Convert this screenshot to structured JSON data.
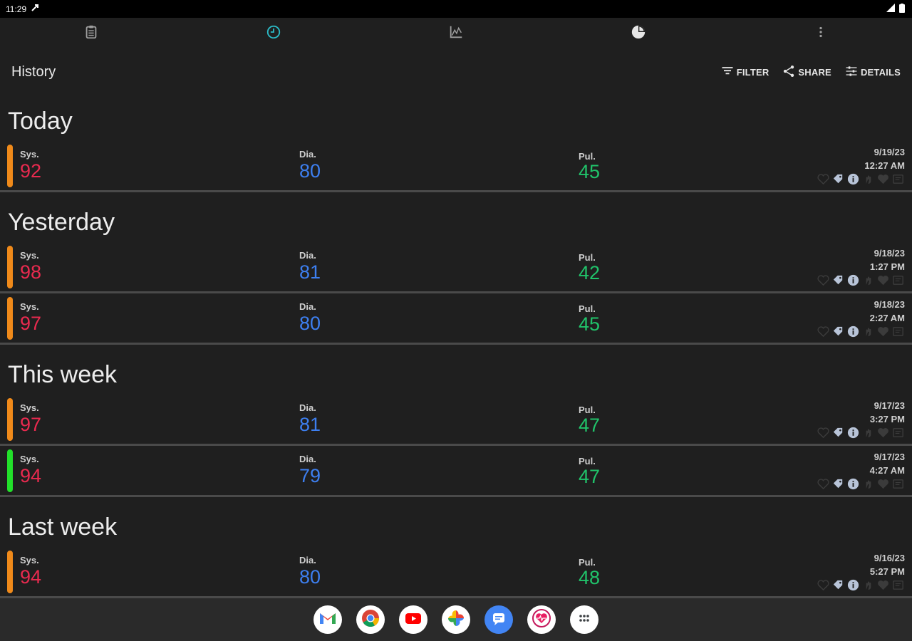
{
  "status": {
    "time": "11:29"
  },
  "nav": {
    "tabs": [
      {
        "name": "clipboard-icon",
        "active": false
      },
      {
        "name": "history-icon",
        "active": true
      },
      {
        "name": "chart-icon",
        "active": false
      },
      {
        "name": "pie-chart-icon",
        "active": false
      },
      {
        "name": "more-icon",
        "active": false
      }
    ]
  },
  "toolbar": {
    "title": "History",
    "filter_label": "FILTER",
    "share_label": "SHARE",
    "details_label": "DETAILS"
  },
  "labels": {
    "sys": "Sys.",
    "dia": "Dia.",
    "pul": "Pul."
  },
  "colors": {
    "sys": "#ea2a4f",
    "dia": "#3d7ff0",
    "pul": "#20c36a",
    "status_orange": "#f08a1a",
    "status_green": "#22e02a",
    "active_tab": "#2bbcc8"
  },
  "sections": [
    {
      "title": "Today",
      "entries": [
        {
          "sys": "92",
          "dia": "80",
          "pul": "45",
          "date": "9/19/23",
          "time": "12:27 AM",
          "status_color": "orange"
        }
      ]
    },
    {
      "title": "Yesterday",
      "entries": [
        {
          "sys": "98",
          "dia": "81",
          "pul": "42",
          "date": "9/18/23",
          "time": "1:27 PM",
          "status_color": "orange"
        },
        {
          "sys": "97",
          "dia": "80",
          "pul": "45",
          "date": "9/18/23",
          "time": "2:27 AM",
          "status_color": "orange"
        }
      ]
    },
    {
      "title": "This week",
      "entries": [
        {
          "sys": "97",
          "dia": "81",
          "pul": "47",
          "date": "9/17/23",
          "time": "3:27 PM",
          "status_color": "orange"
        },
        {
          "sys": "94",
          "dia": "79",
          "pul": "47",
          "date": "9/17/23",
          "time": "4:27 AM",
          "status_color": "green"
        }
      ]
    },
    {
      "title": "Last week",
      "entries": [
        {
          "sys": "94",
          "dia": "80",
          "pul": "48",
          "date": "9/16/23",
          "time": "5:27 PM",
          "status_color": "orange"
        }
      ]
    }
  ],
  "dock": {
    "apps": [
      "gmail-icon",
      "chrome-icon",
      "youtube-icon",
      "photos-icon",
      "messages-icon",
      "health-app-icon",
      "app-drawer-icon"
    ]
  }
}
